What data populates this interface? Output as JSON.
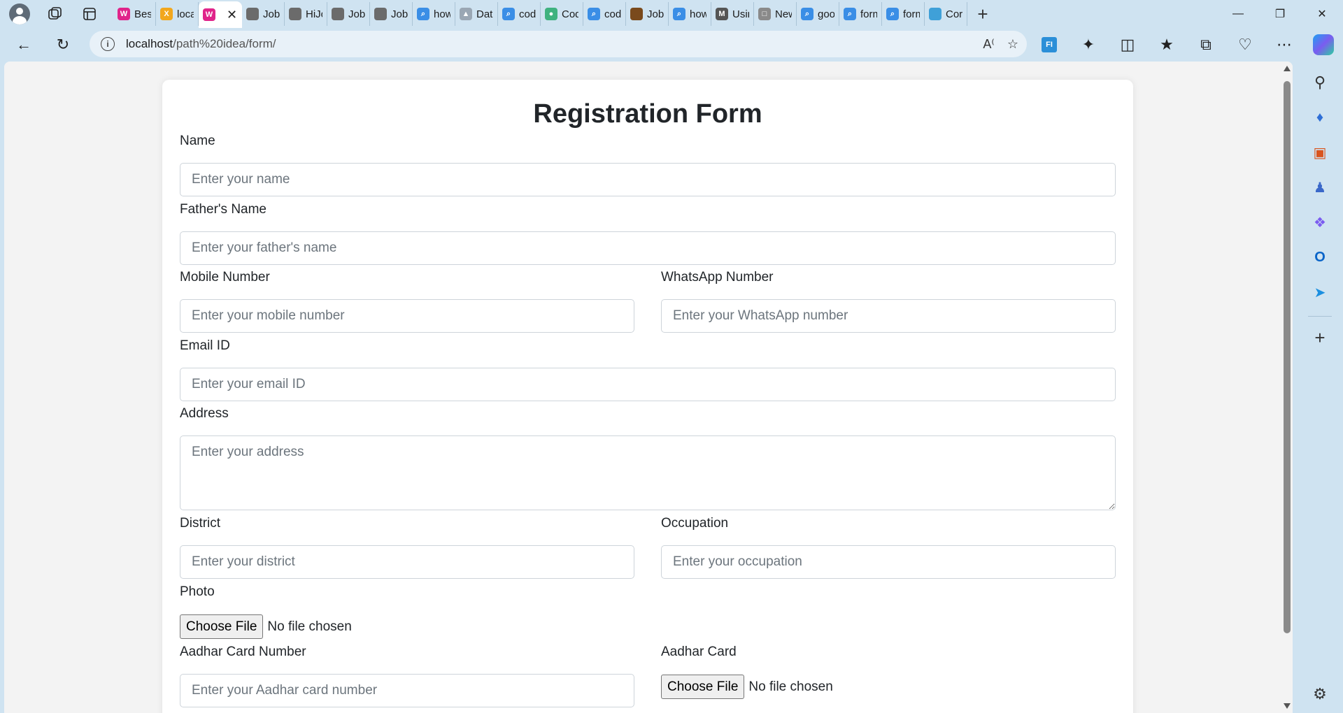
{
  "browser": {
    "tabs": [
      {
        "title": "Best",
        "color": "#e0248a",
        "glyph": "W"
      },
      {
        "title": "locali",
        "color": "#f2a71d",
        "glyph": "X"
      },
      {
        "title": "",
        "color": "#e0248a",
        "glyph": "W",
        "active": true
      },
      {
        "title": "Job L",
        "color": "#6b6b6b",
        "glyph": ""
      },
      {
        "title": "HiJob",
        "color": "#6b6b6b",
        "glyph": ""
      },
      {
        "title": "Jobb",
        "color": "#6b6b6b",
        "glyph": ""
      },
      {
        "title": "Jobs",
        "color": "#6b6b6b",
        "glyph": ""
      },
      {
        "title": "how",
        "color": "#3a8ee6",
        "glyph": "⌕"
      },
      {
        "title": "Data",
        "color": "#9aa7b4",
        "glyph": "▲"
      },
      {
        "title": "code",
        "color": "#3a8ee6",
        "glyph": "⌕"
      },
      {
        "title": "Code",
        "color": "#3fb27f",
        "glyph": "●"
      },
      {
        "title": "code",
        "color": "#3a8ee6",
        "glyph": "⌕"
      },
      {
        "title": "Jobb",
        "color": "#7a4a1c",
        "glyph": ""
      },
      {
        "title": "how",
        "color": "#3a8ee6",
        "glyph": "⌕"
      },
      {
        "title": "Usin",
        "color": "#555555",
        "glyph": "M"
      },
      {
        "title": "New",
        "color": "#8a8a8a",
        "glyph": "□"
      },
      {
        "title": "goo",
        "color": "#3a8ee6",
        "glyph": "⌕"
      },
      {
        "title": "form",
        "color": "#3a8ee6",
        "glyph": "⌕"
      },
      {
        "title": "form",
        "color": "#3a8ee6",
        "glyph": "⌕"
      },
      {
        "title": "Corr",
        "color": "#3fa0d8",
        "glyph": ""
      }
    ],
    "url_host": "localhost",
    "url_path": "/path%20idea/form/"
  },
  "form": {
    "title": "Registration Form",
    "name_label": "Name",
    "name_placeholder": "Enter your name",
    "father_label": "Father's Name",
    "father_placeholder": "Enter your father's name",
    "mobile_label": "Mobile Number",
    "mobile_placeholder": "Enter your mobile number",
    "whatsapp_label": "WhatsApp Number",
    "whatsapp_placeholder": "Enter your WhatsApp number",
    "email_label": "Email ID",
    "email_placeholder": "Enter your email ID",
    "address_label": "Address",
    "address_placeholder": "Enter your address",
    "district_label": "District",
    "district_placeholder": "Enter your district",
    "occupation_label": "Occupation",
    "occupation_placeholder": "Enter your occupation",
    "photo_label": "Photo",
    "aadhar_number_label": "Aadhar Card Number",
    "aadhar_number_placeholder": "Enter your Aadhar card number",
    "aadhar_card_label": "Aadhar Card",
    "file_button": "Choose File",
    "no_file": "No file chosen"
  }
}
